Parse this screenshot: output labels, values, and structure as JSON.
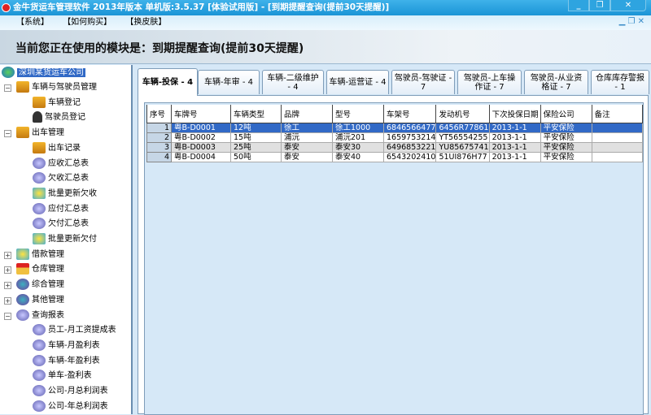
{
  "window": {
    "title": "金牛货运车管理软件  2013年版本  单机版:3.5.37  [体验试用版]  -  [到期提醒查询(提前30天提醒)]"
  },
  "menu": [
    "【系统】",
    "【如何购买】",
    "【换皮肤】"
  ],
  "module_header": "当前您正在使用的模块是：到期提醒查询(提前30天提醒)",
  "tree": {
    "root": "深圳某货运车公司",
    "nodes": [
      {
        "label": "车辆与驾驶员管理",
        "icon": "truck-icon",
        "level": 1,
        "expander": "−"
      },
      {
        "label": "车辆登记",
        "icon": "truck-icon",
        "level": 2
      },
      {
        "label": "驾驶员登记",
        "icon": "driver-icon",
        "level": 2
      },
      {
        "label": "出车管理",
        "icon": "truck-icon",
        "level": 1,
        "expander": "−"
      },
      {
        "label": "出车记录",
        "icon": "truck-icon",
        "level": 2
      },
      {
        "label": "应收汇总表",
        "icon": "disk-icon",
        "level": 2
      },
      {
        "label": "欠收汇总表",
        "icon": "disk-icon",
        "level": 2
      },
      {
        "label": "批量更新欠收",
        "icon": "money-icon",
        "level": 2
      },
      {
        "label": "应付汇总表",
        "icon": "disk-icon",
        "level": 2
      },
      {
        "label": "欠付汇总表",
        "icon": "disk-icon",
        "level": 2
      },
      {
        "label": "批量更新欠付",
        "icon": "money-icon",
        "level": 2
      },
      {
        "label": "借款管理",
        "icon": "money-icon",
        "level": 1,
        "expander": "+"
      },
      {
        "label": "仓库管理",
        "icon": "house-icon",
        "level": 1,
        "expander": "+"
      },
      {
        "label": "综合管理",
        "icon": "gear-icon",
        "level": 1,
        "expander": "+"
      },
      {
        "label": "其他管理",
        "icon": "gear-icon",
        "level": 1,
        "expander": "+"
      },
      {
        "label": "查询报表",
        "icon": "disk-icon",
        "level": 1,
        "expander": "−"
      },
      {
        "label": "员工-月工资提成表",
        "icon": "disk-icon",
        "level": 2
      },
      {
        "label": "车辆-月盈利表",
        "icon": "disk-icon",
        "level": 2
      },
      {
        "label": "车辆-年盈利表",
        "icon": "disk-icon",
        "level": 2
      },
      {
        "label": "单车-盈利表",
        "icon": "disk-icon",
        "level": 2
      },
      {
        "label": "公司-月总利润表",
        "icon": "disk-icon",
        "level": 2
      },
      {
        "label": "公司-年总利润表",
        "icon": "disk-icon",
        "level": 2
      }
    ]
  },
  "tabs": [
    "车辆-投保 - 4",
    "车辆-年审 - 4",
    "车辆-二级维护 - 4",
    "车辆-运营证 - 4",
    "驾驶员-驾驶证 - 7",
    "驾驶员-上车操作证 - 7",
    "驾驶员-从业资格证 - 7",
    "仓库库存警报 - 1"
  ],
  "table": {
    "columns": [
      "序号",
      "车牌号",
      "车辆类型",
      "品牌",
      "型号",
      "车架号",
      "发动机号",
      "下次投保日期",
      "保险公司",
      "备注"
    ],
    "rows": [
      [
        "1",
        "粤B-D0001",
        "12吨",
        "徐工",
        "徐工1000",
        "6846566477",
        "6456R77861",
        "2013-1-1",
        "平安保险",
        ""
      ],
      [
        "2",
        "粤B-D0002",
        "15吨",
        "浦沅",
        "浦沅201",
        "1659753214",
        "YT56554255",
        "2013-1-1",
        "平安保险",
        ""
      ],
      [
        "3",
        "粤B-D0003",
        "25吨",
        "泰安",
        "泰安30",
        "6496853221",
        "YU85675741",
        "2013-1-1",
        "平安保险",
        ""
      ],
      [
        "4",
        "粤B-D0004",
        "50吨",
        "泰安",
        "泰安40",
        "6543202410",
        "51UI876H77",
        "2013-1-1",
        "平安保险",
        ""
      ]
    ]
  }
}
